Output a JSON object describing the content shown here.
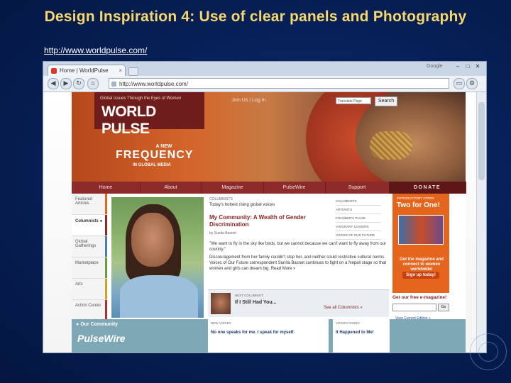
{
  "slide": {
    "title": "Design Inspiration 4: Use of clear panels and Photography",
    "link": "http://www.worldpulse.com/"
  },
  "browser": {
    "tab_title": "Home | WorldPulse",
    "address": "http://www.worldpulse.com/",
    "brand": "Google",
    "window_controls": [
      "–",
      "□",
      "✕"
    ]
  },
  "site": {
    "logo_tagline": "Global Issues Through the Eyes of Women",
    "logo_name": "WORLD PULSE",
    "join": "Join Us | Log In",
    "search_placeholder": "Translate Page",
    "search_button": "Search",
    "hero_small": "A NEW",
    "hero_big": "FREQUENCY",
    "hero_sub": "IN GLOBAL MEDIA",
    "nav": [
      "Home",
      "About",
      "Magazine",
      "PulseWire",
      "Support",
      "DONATE"
    ],
    "sidebar": [
      "Featured Articles",
      "Columnists",
      "Global Gatherings",
      "Marketplace",
      "Arts",
      "Action Center"
    ],
    "columns_label": "COLUMNISTS",
    "columns_sub": "Today's hottest rising global voices",
    "article_title": "My Community: A Wealth of Gender Discrimination",
    "byline": "by Sunita Basnet",
    "quote": "\"We want to fly in the sky like birds, but we cannot because we can't want to fly away from our country.\"",
    "body": "Discouragement from her family couldn't stop her, and neither could restrictive cultural norms. Voices of Our Future correspondent Sunita Basnet continues to fight on a Nepali stage so that women and girls can dream big.  Read More »",
    "side_links": [
      "COLUMNISTS",
      "ARTIVISTS",
      "FOUNDER'S PULSE",
      "VISIONARY LEADERS",
      "VOICES OF OUR FUTURE"
    ],
    "promo": {
      "intro": "INTRODUCTORY OFFER",
      "headline": "Two for One!",
      "text": "Get the magazine and connect to women worldwide!",
      "button": "Sign up today!"
    },
    "free_magazine": "Get our free e-magazine!",
    "go": "Go",
    "view_edition": "View Current Edition »",
    "next_label": "NEXT COLUMNIST:",
    "next_title": "If I Still Had You...",
    "see_all": "See all Columnists »",
    "community_head": "Our Community",
    "community_logo": "PulseWire",
    "new_voices_label": "NEW VOICES",
    "new_voices_text": "No one speaks for me. I speak for myself.",
    "voices_rising_label": "VOICES RISING",
    "voices_rising_text": "It Happened to Me!"
  }
}
